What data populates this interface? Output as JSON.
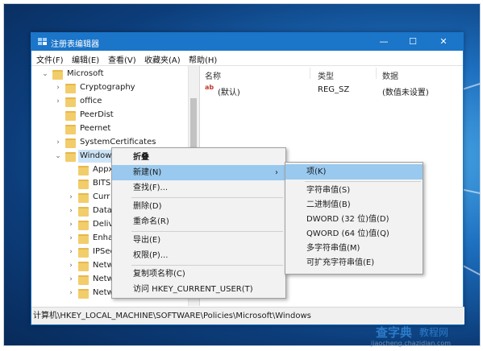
{
  "window": {
    "title": "注册表编辑器",
    "minimize": "—",
    "maximize": "☐",
    "close": "✕"
  },
  "menu": [
    "文件(F)",
    "编辑(E)",
    "查看(V)",
    "收藏夹(A)",
    "帮助(H)"
  ],
  "tree": {
    "root": "Microsoft",
    "items": [
      "Cryptography",
      "office",
      "PeerDist",
      "Peernet",
      "SystemCertificates",
      "Windows"
    ],
    "children": [
      "Appx",
      "BITS",
      "Curr",
      "Data",
      "Deliv",
      "Enha",
      "IPSec",
      "Netw",
      "Netw",
      "Netw"
    ]
  },
  "list": {
    "headers": [
      "名称",
      "类型",
      "数据"
    ],
    "rows": [
      {
        "name": "(默认)",
        "type": "REG_SZ",
        "data": "(数值未设置)",
        "icon": "ab-icon"
      }
    ]
  },
  "status_path": "计算机\\HKEY_LOCAL_MACHINE\\SOFTWARE\\Policies\\Microsoft\\Windows",
  "context_menu": {
    "items": [
      "折叠",
      "新建(N)",
      "查找(F)...",
      "删除(D)",
      "重命名(R)",
      "导出(E)",
      "权限(P)...",
      "复制项名称(C)",
      "访问 HKEY_CURRENT_USER(T)"
    ],
    "submenu_arrow": "›"
  },
  "submenu": {
    "items": [
      "项(K)",
      "字符串值(S)",
      "二进制值(B)",
      "DWORD (32 位)值(D)",
      "QWORD (64 位)值(Q)",
      "多字符串值(M)",
      "可扩充字符串值(E)"
    ]
  },
  "watermark": {
    "brand": "查字典",
    "suffix": "教程网",
    "url": "jiaocheng.chazidian.com"
  },
  "colors": {
    "titlebar": "#1b75c9",
    "highlight": "#99c9ef",
    "menu_bg": "#f2f2f2",
    "folder": "#f2cd6b"
  }
}
